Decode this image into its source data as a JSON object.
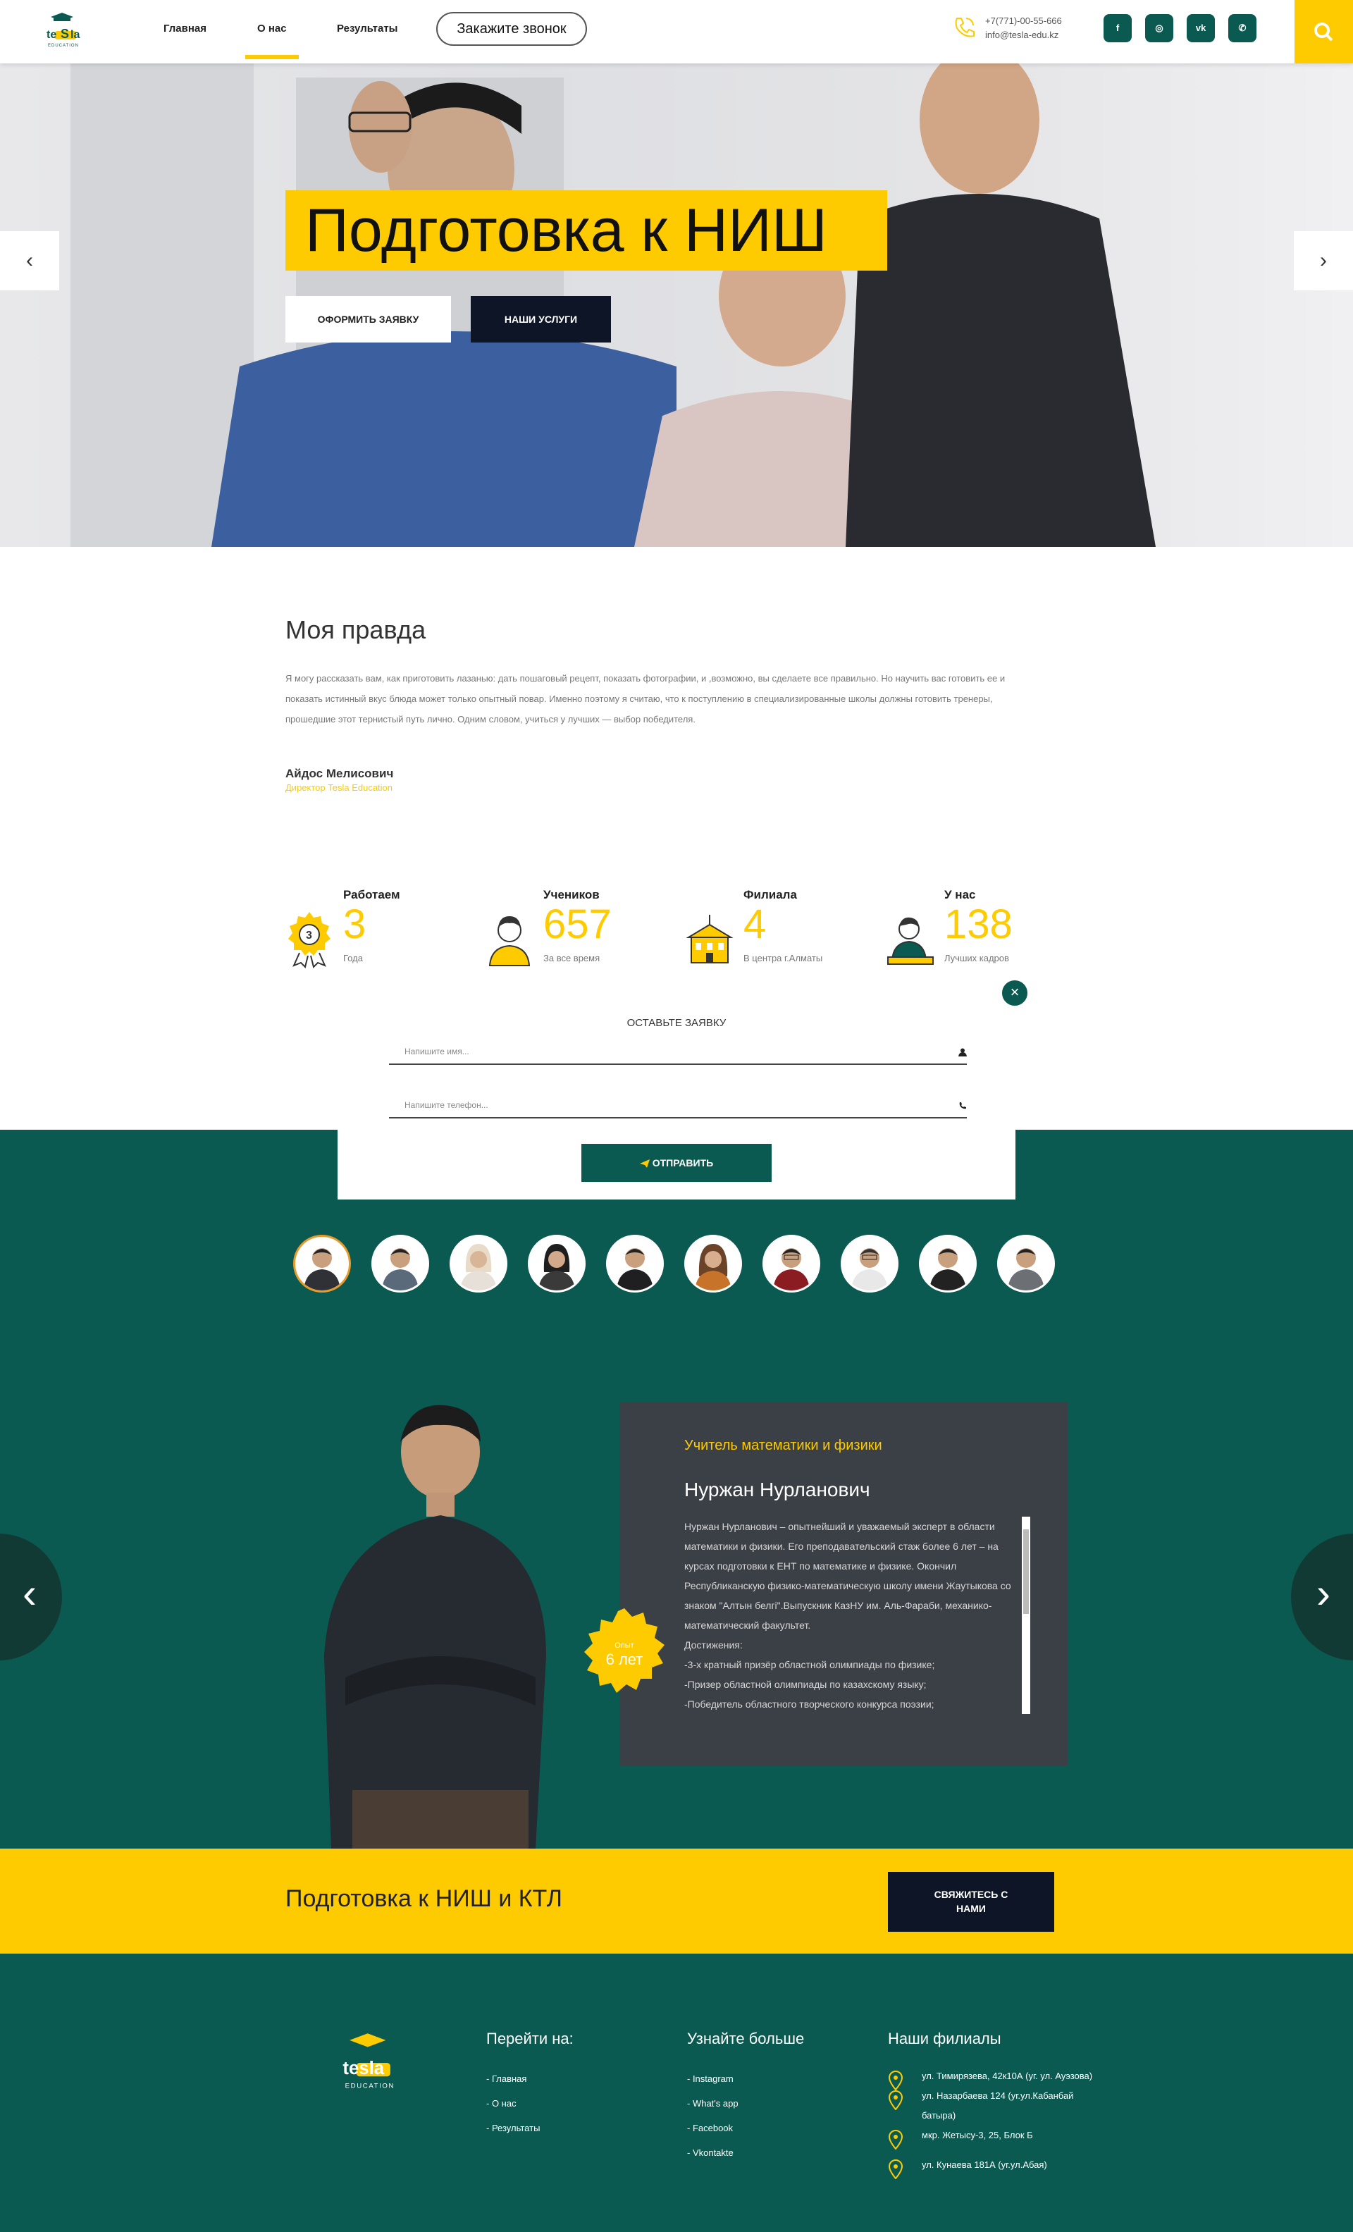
{
  "header": {
    "nav": [
      "Главная",
      "О нас",
      "Результаты"
    ],
    "call_button": "Закажите звонок",
    "phone": "+7(771)-00-55-666",
    "email": "info@tesla-edu.kz",
    "social": [
      "f",
      "◎",
      "vk",
      "✆"
    ],
    "brand_color": "#fecb00",
    "accent_teal": "#0b5a52"
  },
  "hero": {
    "title": "Подготовка к НИШ",
    "btn_apply": "ОФОРМИТЬ ЗАЯВКУ",
    "btn_services": "НАШИ УСЛУГИ",
    "prev": "‹",
    "next": "›"
  },
  "quote": {
    "title": "Моя правда",
    "text": "Я могу рассказать вам, как приготовить лазанью: дать пошаговый рецепт, показать фотографии, и ,возможно, вы сделаете все правильно. Но научить вас готовить ее и показать истинный вкус блюда может только опытный повар. Именно поэтому я считаю, что к поступлению в специализированные школы должны готовить тренеры, прошедшие этот тернистый путь лично. Одним словом, учиться у лучших — выбор победителя.",
    "author": "Айдос Мелисович",
    "author_role": "Директор Tesla Education"
  },
  "stats": [
    {
      "label": "Работаем",
      "number": "3",
      "sub": "Года",
      "icon": "award-icon"
    },
    {
      "label": "Учеников",
      "number": "657",
      "sub": "За все время",
      "icon": "student-icon"
    },
    {
      "label": "Филиала",
      "number": "4",
      "sub": "В центра г.Алматы",
      "icon": "school-building-icon"
    },
    {
      "label": "У нас",
      "number": "138",
      "sub": "Лучших кадров",
      "icon": "teacher-icon"
    }
  ],
  "form": {
    "title": "ОСТАВЬТЕ ЗАЯВКУ",
    "name_placeholder": "Напишите имя...",
    "phone_placeholder": "Напишите телефон...",
    "submit": "ОТПРАВИТЬ",
    "close": "×"
  },
  "teacher": {
    "role": "Учитель математики и физики",
    "name": "Нуржан Нурланович",
    "bio": [
      "Нуржан Нурланович – опытнейший и уважаемый эксперт в области математики и физики. Его преподавательский стаж более 6 лет – на курсах подготовки к ЕНТ по математике и физике. Окончил Республиканскую физико-математическую школу имени Жаутыкова со знаком \"Алтын белгі\".Выпускник КазНУ им. Аль-Фараби, механико-математический факультет.",
      "Достижения:",
      "-3-х кратный призёр областной олимпиады по физике;",
      "-Призер областной олимпиады по казахскому языку;",
      "-Победитель областного творческого конкурса поэзии;"
    ],
    "badge_small": "Опыт",
    "badge_years": "6 лет",
    "prev": "‹",
    "next": "›"
  },
  "cta": {
    "title": "Подготовка к НИШ и КТЛ",
    "button": "СВЯЖИТЕСЬ С НАМИ"
  },
  "footer": {
    "nav_title": "Перейти на:",
    "nav": [
      "- Главная",
      "- О нас",
      "- Результаты"
    ],
    "more_title": "Узнайте больше",
    "more": [
      "- Instagram",
      "- What's app",
      "- Facebook",
      "- Vkontakte"
    ],
    "branches_title": "Наши филиалы",
    "branches": [
      "ул. Тимирязева, 42к10А (уг. ул. Ауэзова)",
      "ул. Назарбаева 124 (уг.ул.Кабанбай батыра)",
      "мкр. Жетысу-3, 25, Блок Б",
      "ул. Кунаева 181А (уг.ул.Абая)"
    ]
  },
  "logo_text": "tesla",
  "logo_sub": "EDUCATION"
}
